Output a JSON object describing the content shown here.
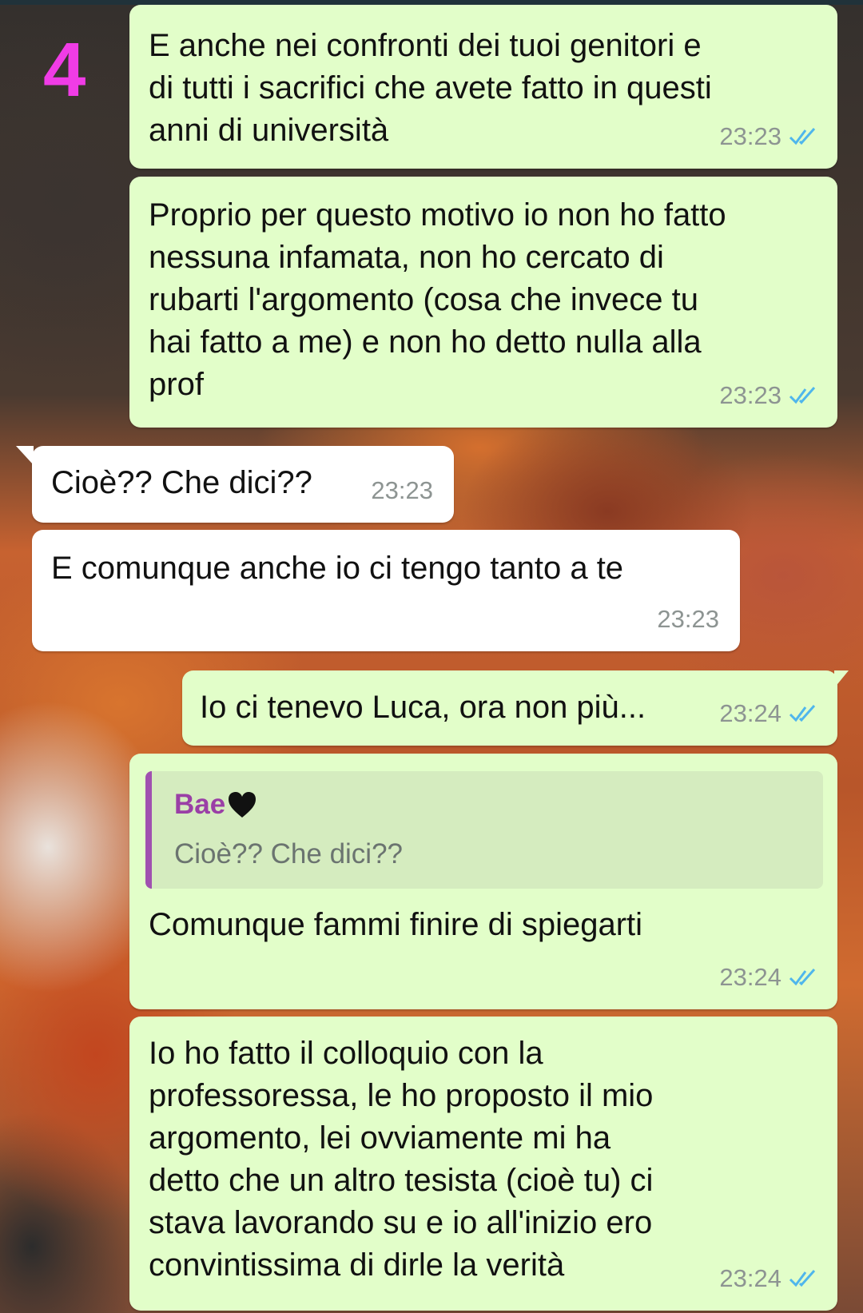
{
  "annotation": {
    "badge": "4"
  },
  "messages": [
    {
      "text": "E anche nei confronti dei tuoi genitori e\ndi tutti i sacrifici che avete fatto in questi\nanni di università",
      "time": "23:23",
      "direction": "outgoing",
      "status": "read"
    },
    {
      "text": "Proprio per questo motivo io non ho fatto\nnessuna infamata, non ho cercato di\nrubarti l'argomento (cosa che invece tu\nhai fatto a me) e non ho detto nulla alla\nprof",
      "time": "23:23",
      "direction": "outgoing",
      "status": "read"
    },
    {
      "text": "Cioè?? Che dici??",
      "time": "23:23",
      "direction": "incoming"
    },
    {
      "text": "E comunque anche io ci tengo tanto a te",
      "time": "23:23",
      "direction": "incoming"
    },
    {
      "text": "Io ci tenevo Luca, ora non più...",
      "time": "23:24",
      "direction": "outgoing",
      "status": "read"
    },
    {
      "quote": {
        "author": "Bae",
        "text": "Cioè?? Che dici??"
      },
      "text": "Comunque fammi finire di spiegarti",
      "time": "23:24",
      "direction": "outgoing",
      "status": "read"
    },
    {
      "text": "Io ho fatto il colloquio con la\nprofessoressa, le ho proposto il mio\nargomento, lei ovviamente mi ha\ndetto che un altro tesista (cioè tu) ci\nstava lavorando su e io all'inizio ero\nconvintissima di dirle la verità",
      "time": "23:24",
      "direction": "outgoing",
      "status": "read"
    }
  ],
  "colors": {
    "outgoing_bubble": "#e2fec9",
    "incoming_bubble": "#ffffff",
    "read_ticks": "#4fb6ec",
    "badge": "#f03ce6",
    "quote_accent": "#a050b0"
  },
  "icons": {
    "read_receipt": "double-check-icon",
    "heart": "black-heart-icon"
  }
}
